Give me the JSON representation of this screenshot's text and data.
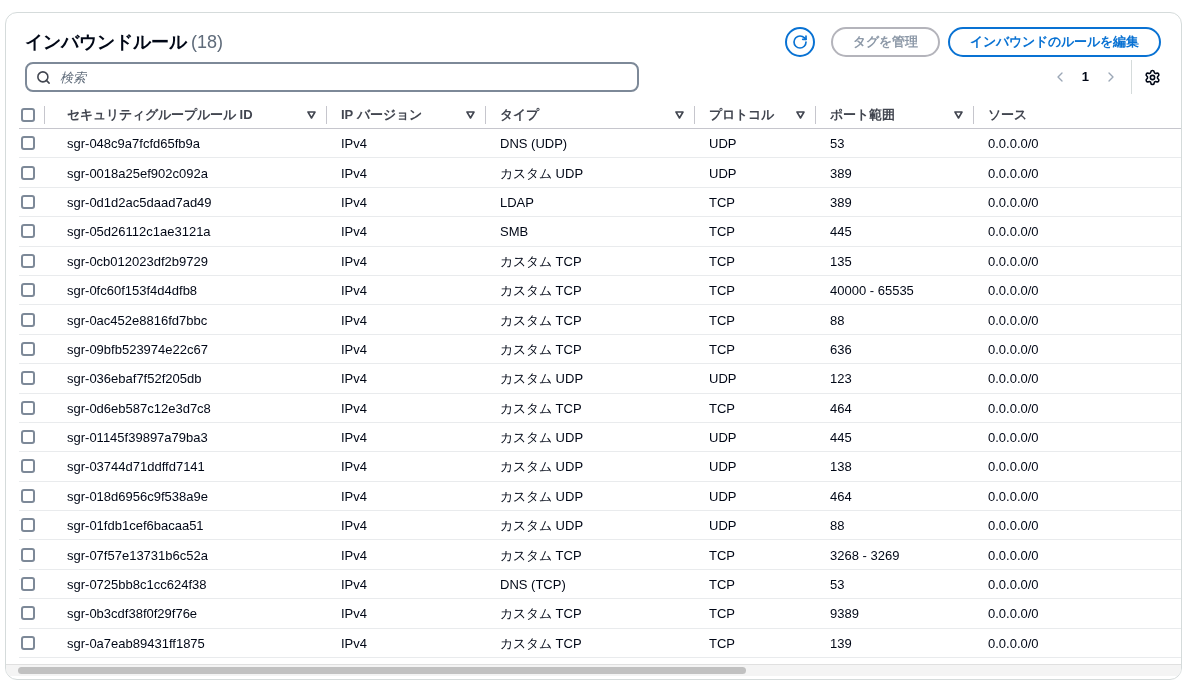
{
  "header": {
    "title": "インバウンドルール",
    "count": "(18)",
    "buttons": [
      {
        "label": "タグを管理",
        "disabled": true
      },
      {
        "label": "インバウンドのルールを編集",
        "disabled": false
      }
    ]
  },
  "search": {
    "placeholder": "検索"
  },
  "pagination": {
    "page": "1"
  },
  "table": {
    "columns": [
      "セキュリティグループルール ID",
      "IP バージョン",
      "タイプ",
      "プロトコル",
      "ポート範囲",
      "ソース"
    ],
    "all_checked": false,
    "rows": [
      {
        "checked": false,
        "cells": [
          "sgr-048c9a7fcfd65fb9a",
          "IPv4",
          "DNS (UDP)",
          "UDP",
          "53",
          "0.0.0.0/0"
        ]
      },
      {
        "checked": false,
        "cells": [
          "sgr-0018a25ef902c092a",
          "IPv4",
          "カスタム UDP",
          "UDP",
          "389",
          "0.0.0.0/0"
        ]
      },
      {
        "checked": false,
        "cells": [
          "sgr-0d1d2ac5daad7ad49",
          "IPv4",
          "LDAP",
          "TCP",
          "389",
          "0.0.0.0/0"
        ]
      },
      {
        "checked": false,
        "cells": [
          "sgr-05d26112c1ae3121a",
          "IPv4",
          "SMB",
          "TCP",
          "445",
          "0.0.0.0/0"
        ]
      },
      {
        "checked": false,
        "cells": [
          "sgr-0cb012023df2b9729",
          "IPv4",
          "カスタム TCP",
          "TCP",
          "135",
          "0.0.0.0/0"
        ]
      },
      {
        "checked": false,
        "cells": [
          "sgr-0fc60f153f4d4dfb8",
          "IPv4",
          "カスタム TCP",
          "TCP",
          "40000 - 65535",
          "0.0.0.0/0"
        ]
      },
      {
        "checked": false,
        "cells": [
          "sgr-0ac452e8816fd7bbc",
          "IPv4",
          "カスタム TCP",
          "TCP",
          "88",
          "0.0.0.0/0"
        ]
      },
      {
        "checked": false,
        "cells": [
          "sgr-09bfb523974e22c67",
          "IPv4",
          "カスタム TCP",
          "TCP",
          "636",
          "0.0.0.0/0"
        ]
      },
      {
        "checked": false,
        "cells": [
          "sgr-036ebaf7f52f205db",
          "IPv4",
          "カスタム UDP",
          "UDP",
          "123",
          "0.0.0.0/0"
        ]
      },
      {
        "checked": false,
        "cells": [
          "sgr-0d6eb587c12e3d7c8",
          "IPv4",
          "カスタム TCP",
          "TCP",
          "464",
          "0.0.0.0/0"
        ]
      },
      {
        "checked": false,
        "cells": [
          "sgr-01145f39897a79ba3",
          "IPv4",
          "カスタム UDP",
          "UDP",
          "445",
          "0.0.0.0/0"
        ]
      },
      {
        "checked": false,
        "cells": [
          "sgr-03744d71ddffd7141",
          "IPv4",
          "カスタム UDP",
          "UDP",
          "138",
          "0.0.0.0/0"
        ]
      },
      {
        "checked": false,
        "cells": [
          "sgr-018d6956c9f538a9e",
          "IPv4",
          "カスタム UDP",
          "UDP",
          "464",
          "0.0.0.0/0"
        ]
      },
      {
        "checked": false,
        "cells": [
          "sgr-01fdb1cef6bacaa51",
          "IPv4",
          "カスタム UDP",
          "UDP",
          "88",
          "0.0.0.0/0"
        ]
      },
      {
        "checked": false,
        "cells": [
          "sgr-07f57e13731b6c52a",
          "IPv4",
          "カスタム TCP",
          "TCP",
          "3268 - 3269",
          "0.0.0.0/0"
        ]
      },
      {
        "checked": false,
        "cells": [
          "sgr-0725bb8c1cc624f38",
          "IPv4",
          "DNS (TCP)",
          "TCP",
          "53",
          "0.0.0.0/0"
        ]
      },
      {
        "checked": false,
        "cells": [
          "sgr-0b3cdf38f0f29f76e",
          "IPv4",
          "カスタム TCP",
          "TCP",
          "9389",
          "0.0.0.0/0"
        ]
      },
      {
        "checked": false,
        "cells": [
          "sgr-0a7eab89431ff1875",
          "IPv4",
          "カスタム TCP",
          "TCP",
          "139",
          "0.0.0.0/0"
        ]
      }
    ]
  }
}
